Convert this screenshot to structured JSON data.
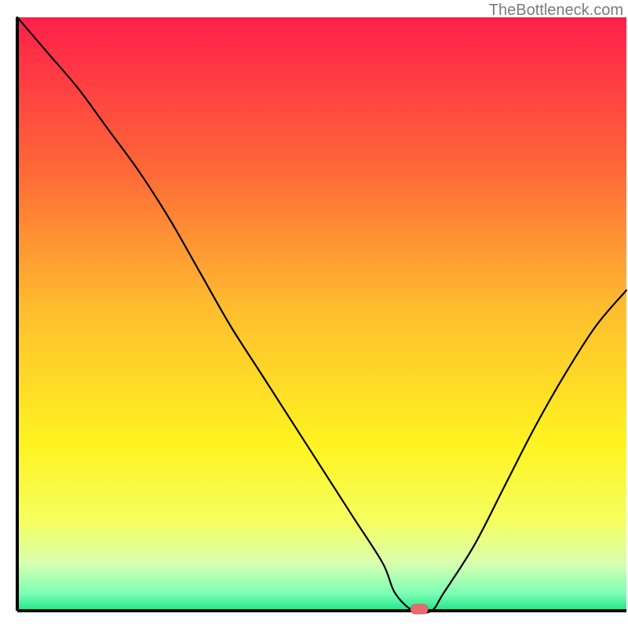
{
  "watermark": "TheBottleneck.com",
  "chart_data": {
    "type": "line",
    "title": "",
    "xlabel": "",
    "ylabel": "",
    "xlim": [
      0,
      100
    ],
    "ylim": [
      0,
      100
    ],
    "x": [
      0,
      5,
      10,
      15,
      20,
      25,
      30,
      35,
      40,
      45,
      50,
      55,
      60,
      62,
      65,
      68,
      70,
      75,
      80,
      85,
      90,
      95,
      100
    ],
    "values": [
      100,
      94,
      88,
      81,
      74,
      66,
      57,
      48,
      40,
      32,
      24,
      16,
      8,
      3,
      0,
      0,
      3,
      11,
      21,
      31,
      40,
      48,
      54
    ],
    "optimal_marker": {
      "x": 66,
      "y": 0
    },
    "background_gradient_stops": [
      {
        "offset": 0,
        "color": "#ff1f4b"
      },
      {
        "offset": 25,
        "color": "#ff6638"
      },
      {
        "offset": 50,
        "color": "#ffc02e"
      },
      {
        "offset": 72,
        "color": "#fff321"
      },
      {
        "offset": 85,
        "color": "#f5ff60"
      },
      {
        "offset": 92,
        "color": "#d8ffb0"
      },
      {
        "offset": 97,
        "color": "#7dffb5"
      },
      {
        "offset": 100,
        "color": "#21e58a"
      }
    ],
    "axis_stroke": "#000000",
    "axis_width": 4,
    "curve_stroke": "#000000",
    "curve_width": 2.2,
    "marker_fill": "#e86a6f",
    "marker_stroke": "#d05a60"
  }
}
